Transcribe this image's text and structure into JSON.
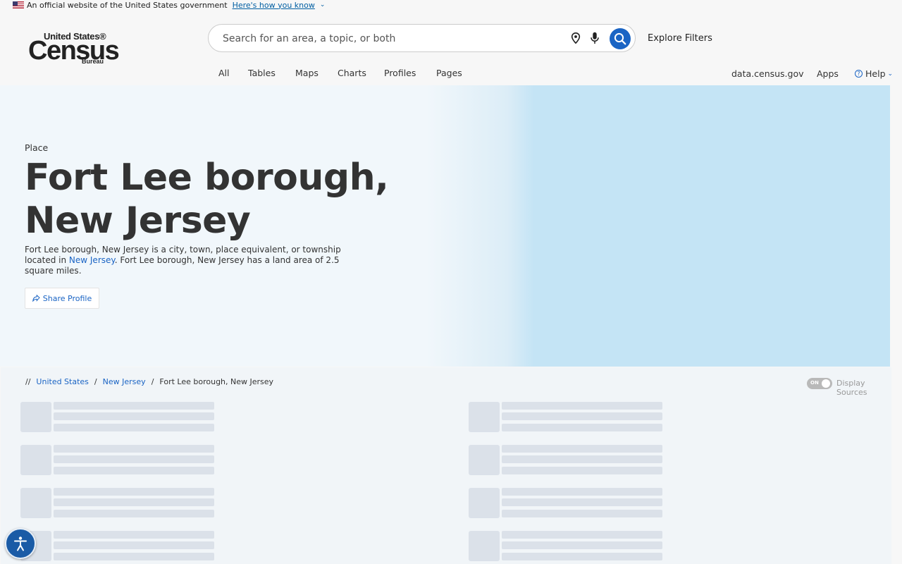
{
  "gov_banner": {
    "text": "An official website of the United States government",
    "link": "Here's how you know"
  },
  "logo": {
    "line1": "United States®",
    "line2": "Census",
    "line3": "Bureau"
  },
  "search": {
    "placeholder": "Search for an area, a topic, or both",
    "value": ""
  },
  "header": {
    "explore_filters": "Explore Filters",
    "tabs": [
      "All",
      "Tables",
      "Maps",
      "Charts",
      "Profiles",
      "Pages"
    ],
    "right_links": [
      "data.census.gov",
      "Apps"
    ],
    "help": "Help"
  },
  "hero": {
    "type": "Place",
    "title": "Fort Lee borough, New Jersey",
    "desc_part1": "Fort Lee borough, New Jersey is a city, town, place equivalent, or township located in ",
    "desc_link": "New Jersey",
    "desc_part2": ". Fort Lee borough, New Jersey has a land area of 2.5 square miles.",
    "share": "Share Profile"
  },
  "breadcrumb": {
    "prefix": "//",
    "items": [
      "United States",
      "New Jersey",
      "Fort Lee borough, New Jersey"
    ]
  },
  "display_sources": {
    "toggle": "ON",
    "label": "Display Sources"
  },
  "colors": {
    "primary_blue": "#1a64c4",
    "skeleton": "#dbe1e9",
    "hero_map": "#c4e4f5"
  }
}
